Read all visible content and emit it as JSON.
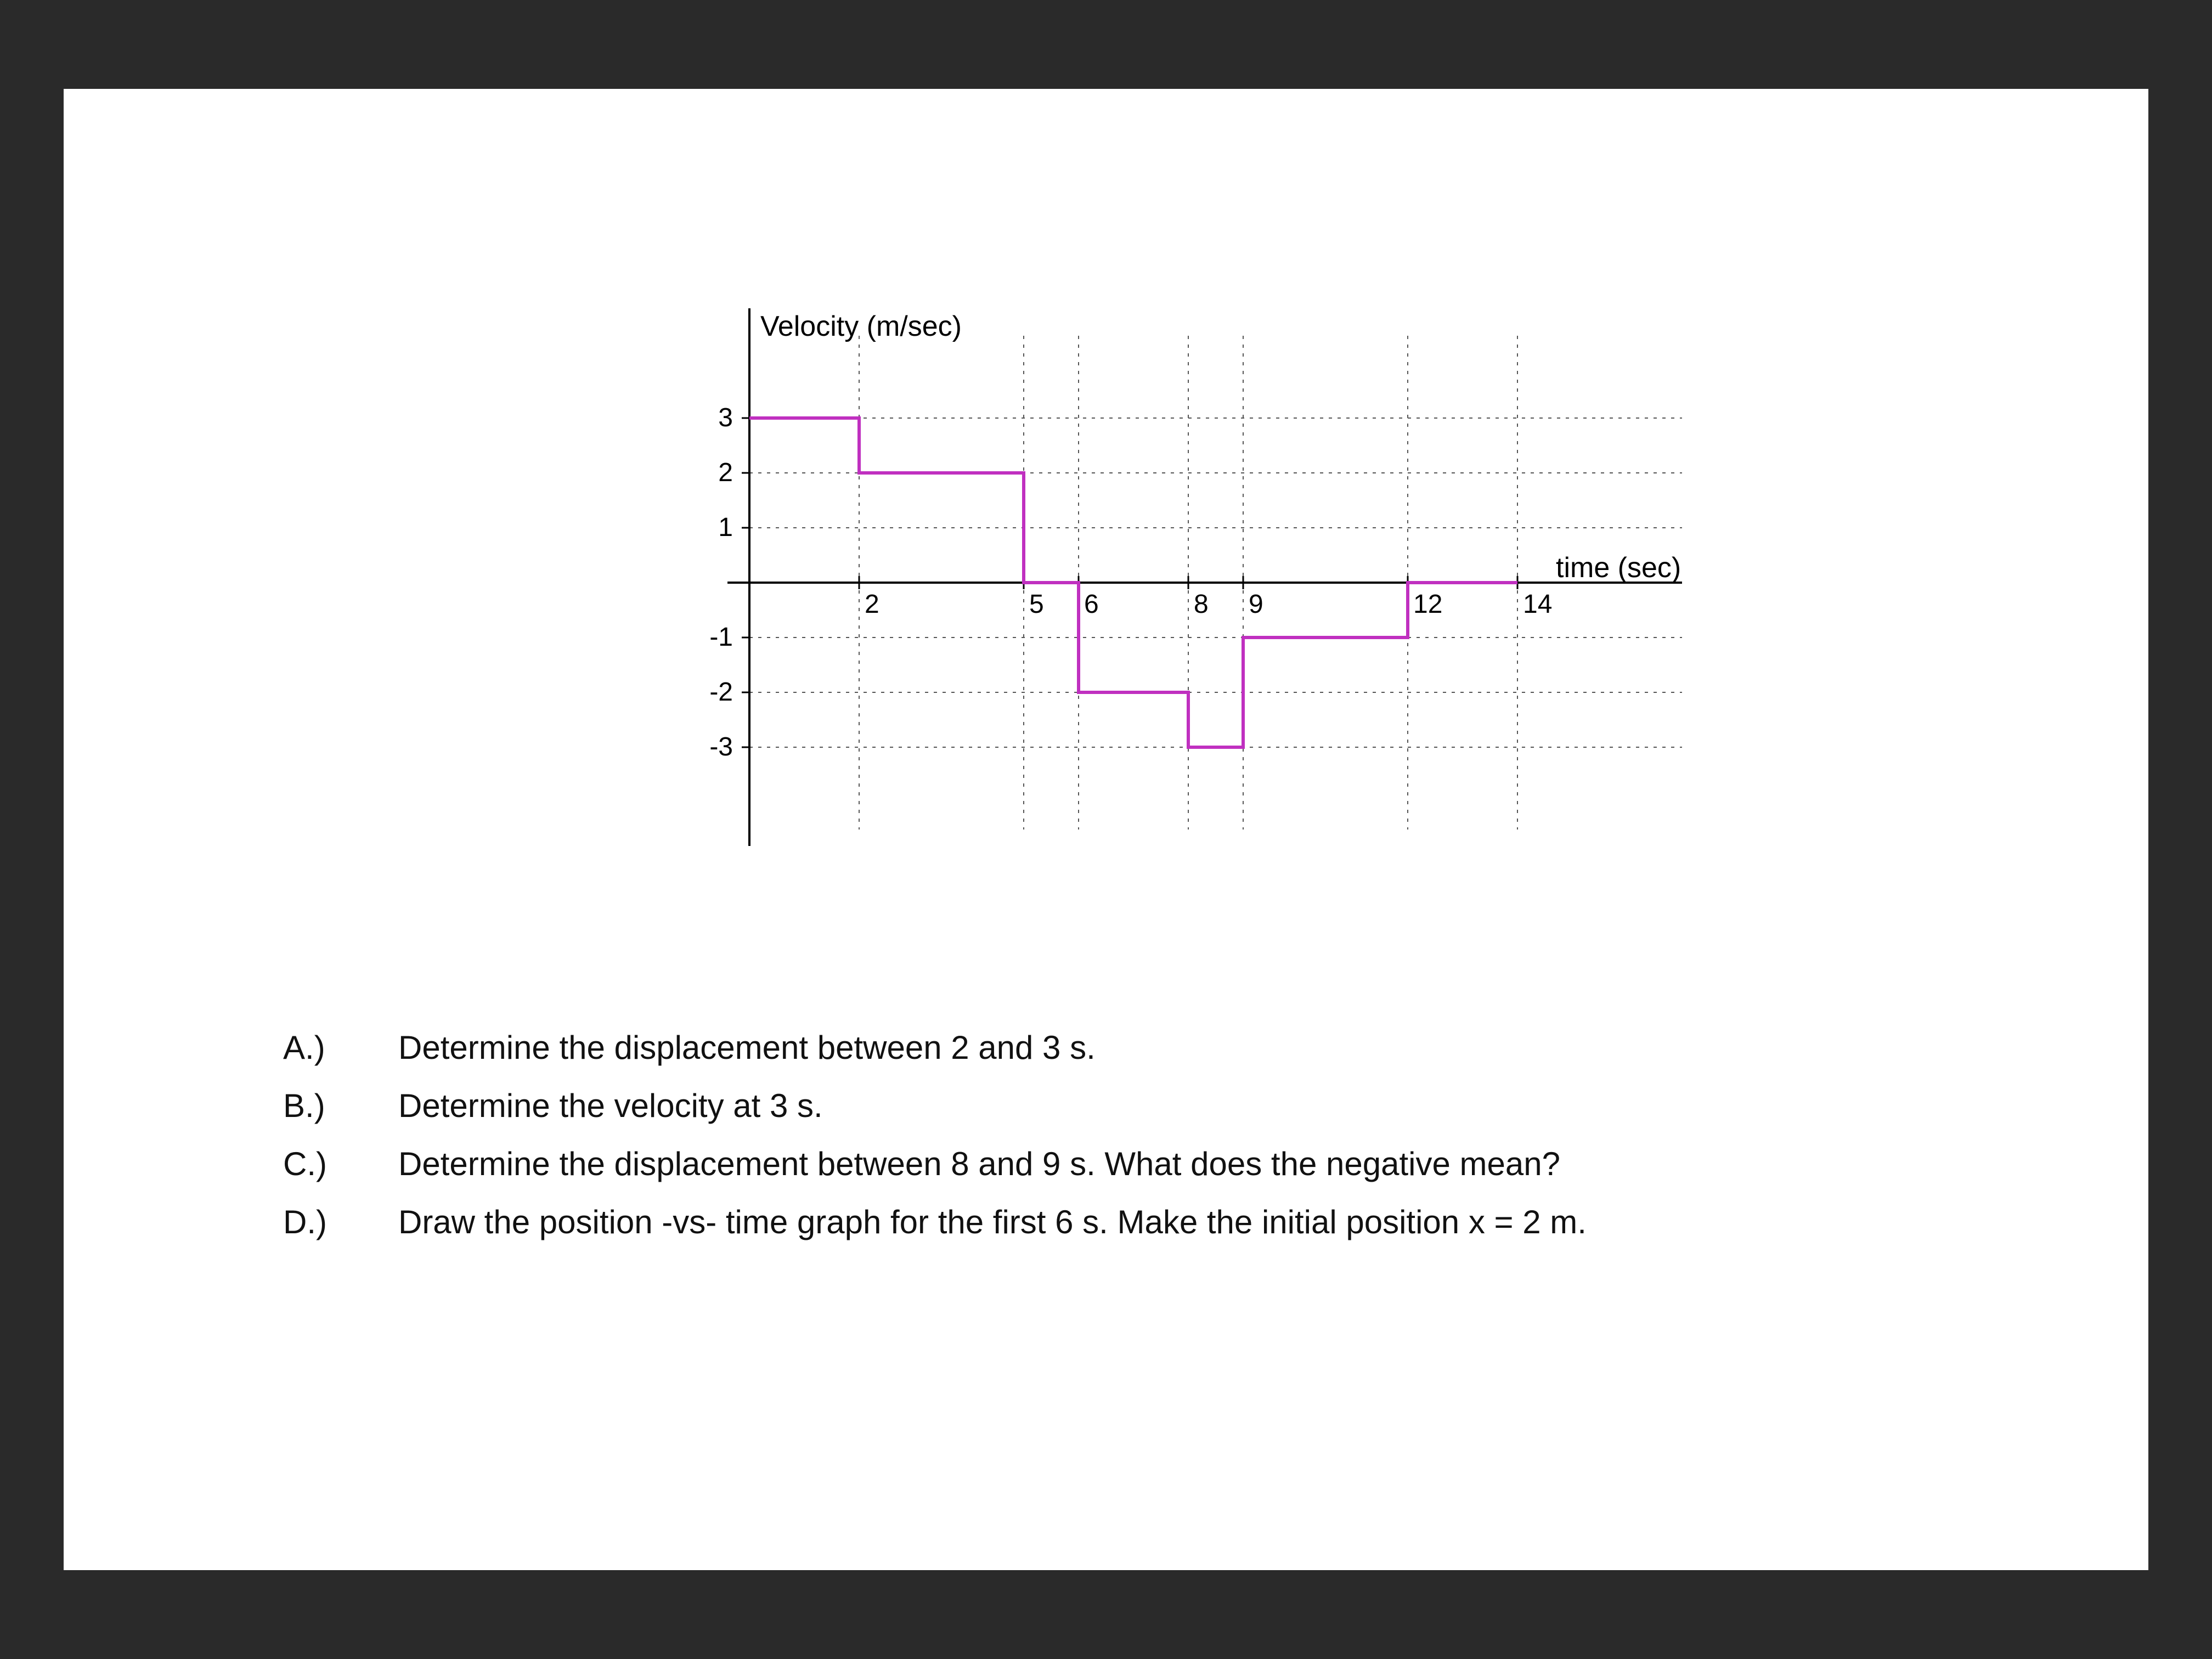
{
  "chart_data": {
    "type": "line",
    "title": "Velocity (m/sec)",
    "xlabel": "time (sec)",
    "ylabel": "",
    "xlim": [
      0,
      16
    ],
    "ylim": [
      -3,
      3
    ],
    "x_ticks_labeled": [
      2,
      5,
      6,
      8,
      9,
      12,
      14
    ],
    "y_ticks_labeled": [
      3,
      2,
      1,
      -1,
      -2,
      -3
    ],
    "series": [
      {
        "name": "velocity",
        "points": [
          {
            "t": 0,
            "v": 3
          },
          {
            "t": 2,
            "v": 3
          },
          {
            "t": 2,
            "v": 2
          },
          {
            "t": 5,
            "v": 2
          },
          {
            "t": 5,
            "v": 0
          },
          {
            "t": 6,
            "v": 0
          },
          {
            "t": 6,
            "v": -2
          },
          {
            "t": 8,
            "v": -2
          },
          {
            "t": 8,
            "v": -3
          },
          {
            "t": 9,
            "v": -3
          },
          {
            "t": 9,
            "v": -1
          },
          {
            "t": 12,
            "v": -1
          },
          {
            "t": 12,
            "v": 0
          },
          {
            "t": 14,
            "v": 0
          }
        ]
      }
    ]
  },
  "questions": {
    "a": {
      "label": "A.)",
      "text": "Determine the displacement between 2 and 3 s."
    },
    "b": {
      "label": "B.)",
      "text": "Determine the velocity at 3 s."
    },
    "c": {
      "label": "C.)",
      "text": "Determine the displacement between 8 and 9 s.  What does the negative mean?"
    },
    "d": {
      "label": "D.)",
      "text": "Draw the position -vs- time graph for the first 6 s.  Make the initial position x = 2 m."
    }
  }
}
